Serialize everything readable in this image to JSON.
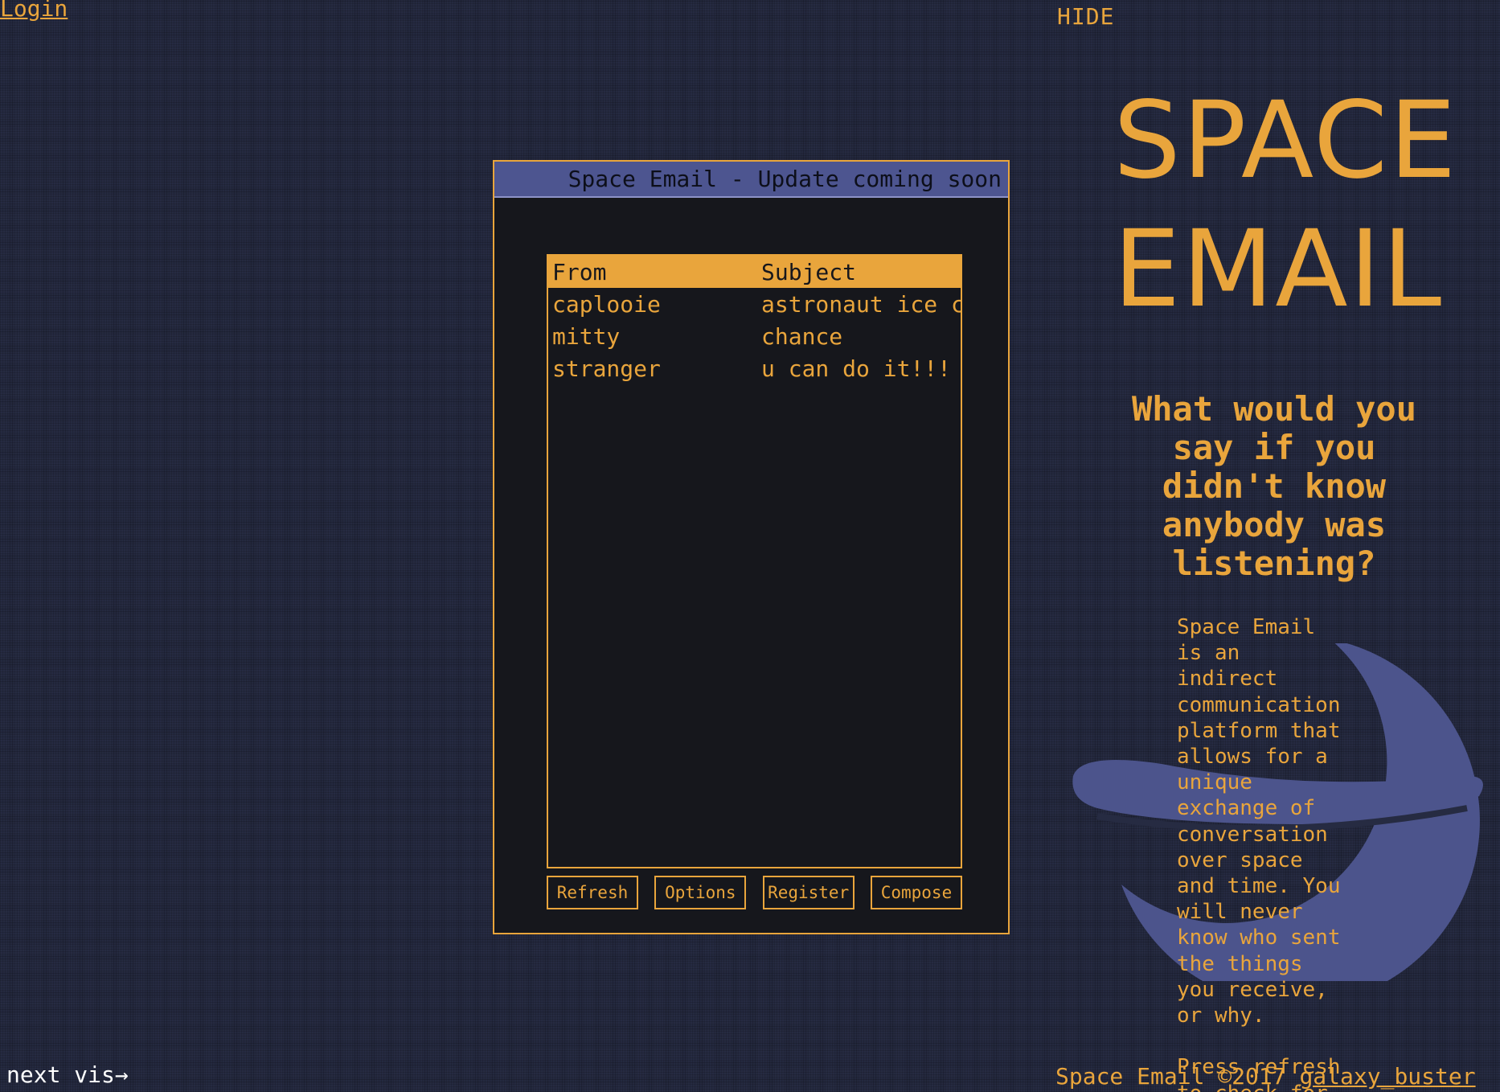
{
  "nav": {
    "login": "Login",
    "hide": "HIDE",
    "next": "next vis→"
  },
  "window": {
    "title": "Space Email - Update coming soon",
    "columns": {
      "from": "From",
      "subject": "Subject"
    },
    "emails": [
      {
        "from": "caplooie",
        "subject": "astronaut ice cream"
      },
      {
        "from": "mitty",
        "subject": "chance"
      },
      {
        "from": "stranger",
        "subject": "u can do it!!!"
      }
    ],
    "buttons": {
      "refresh": "Refresh",
      "options": "Options",
      "register": "Register",
      "compose": "Compose"
    }
  },
  "panel": {
    "title_line1": "SPACE",
    "title_line2": "EMAIL",
    "tagline": "What would you say if you didn't know anybody was listening?",
    "description": "Space Email\nis an\nindirect\ncommunication\nplatform that\nallows for a\nunique\nexchange of\nconversation\nover space\nand time. You\nwill never\nknow who sent\nthe things\nyou receive,\nor why.\n\nPress refresh\nto check for"
  },
  "footer": {
    "text": "Space Email ©2017 ",
    "author": "galaxy_buster"
  },
  "colors": {
    "accent": "#e9a53c",
    "background": "#262b42",
    "titlebar": "#4d5590",
    "window_bg": "#16171c",
    "moon": "#4c548c"
  },
  "icons": {
    "moon": "crescent-moon-icon"
  }
}
